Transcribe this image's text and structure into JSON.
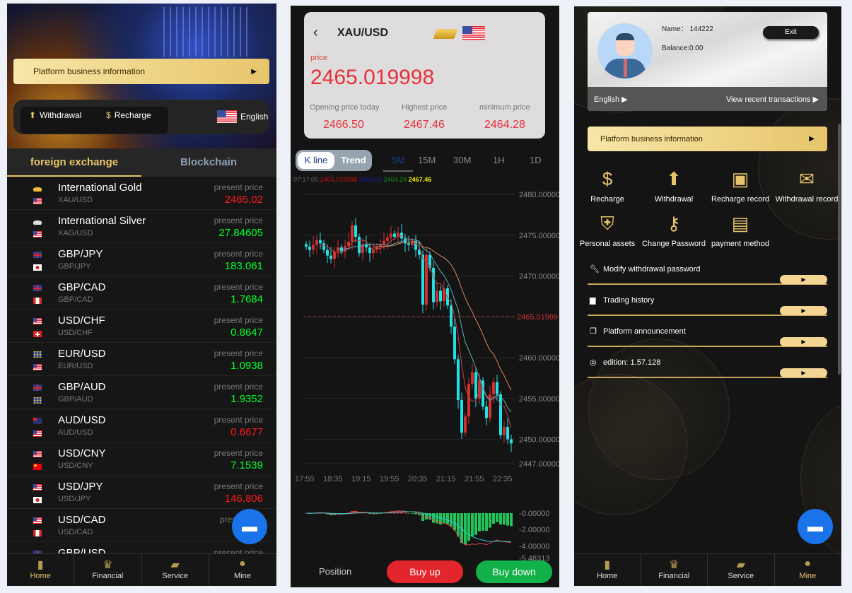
{
  "home": {
    "banner": "Platform business information",
    "withdrawal": "Withdrawal",
    "recharge": "Recharge",
    "language": "English",
    "tabs": [
      "foreign exchange",
      "Blockchain"
    ],
    "price_label": "present price",
    "rows": [
      {
        "name": "International Gold",
        "code": "XAU/USD",
        "price": "2465.02",
        "dir": "down",
        "f1": "gold",
        "f2": "us"
      },
      {
        "name": "International Silver",
        "code": "XAG/USD",
        "price": "27.84605",
        "dir": "up",
        "f1": "silver",
        "f2": "us"
      },
      {
        "name": "GBP/JPY",
        "code": "GBP/JPY",
        "price": "183.061",
        "dir": "up",
        "f1": "gb",
        "f2": "jp"
      },
      {
        "name": "GBP/CAD",
        "code": "GBP/CAD",
        "price": "1.7684",
        "dir": "up",
        "f1": "gb",
        "f2": "ca"
      },
      {
        "name": "USD/CHF",
        "code": "USD/CHF",
        "price": "0.8647",
        "dir": "up",
        "f1": "us",
        "f2": "ch"
      },
      {
        "name": "EUR/USD",
        "code": "EUR/USD",
        "price": "1.0938",
        "dir": "up",
        "f1": "eu",
        "f2": "us"
      },
      {
        "name": "GBP/AUD",
        "code": "GBP/AUD",
        "price": "1.9352",
        "dir": "up",
        "f1": "gb",
        "f2": "eu"
      },
      {
        "name": "AUD/USD",
        "code": "AUD/USD",
        "price": "0.6677",
        "dir": "down",
        "f1": "au",
        "f2": "us"
      },
      {
        "name": "USD/CNY",
        "code": "USD/CNY",
        "price": "7.1539",
        "dir": "up",
        "f1": "us",
        "f2": "cn"
      },
      {
        "name": "USD/JPY",
        "code": "USD/JPY",
        "price": "146.806",
        "dir": "down",
        "f1": "us",
        "f2": "jp"
      },
      {
        "name": "USD/CAD",
        "code": "USD/CAD",
        "price": "",
        "dir": "up",
        "f1": "us",
        "f2": "ca"
      },
      {
        "name": "GBP/USD",
        "code": "",
        "price": "",
        "dir": "up",
        "f1": "gb",
        "f2": "us"
      }
    ],
    "price_label_partial": "prese",
    "nav": [
      "Home",
      "Financial",
      "Service",
      "Mine"
    ]
  },
  "colors": {
    "up": "#00ff2a",
    "down": "#ff1a1a",
    "gold": "#e8c46a",
    "candle_up": "#d2302e",
    "candle_down": "#1de2e8"
  },
  "detail": {
    "symbol": "XAU/USD",
    "price_label": "price",
    "price": "2465.019998",
    "stats": [
      {
        "label": "Opening price today",
        "value": "2466.50"
      },
      {
        "label": "Highest price",
        "value": "2467.46"
      },
      {
        "label": "minimum price",
        "value": "2464.28"
      }
    ],
    "modes": [
      "K line",
      "Trend"
    ],
    "timeframes": [
      "5M",
      "15M",
      "30M",
      "1H",
      "1D"
    ],
    "active_timeframe": "5M",
    "info": {
      "time": "07:17:00",
      "price": "2465.019998",
      "open": "2466.50",
      "low": "2464.28",
      "high": "2467.46"
    },
    "position": "Position",
    "buy_up": "Buy up",
    "buy_down": "Buy down"
  },
  "kline": {
    "y_ticks": [
      "2480.00000",
      "2475.00000",
      "2470.00000",
      "2460.00000",
      "2455.00000",
      "2450.00000",
      "2447.00000"
    ],
    "y_values": [
      2480,
      2475,
      2470,
      2460,
      2455,
      2450,
      2447
    ],
    "current_label": "2465.01999",
    "current": 2465.02,
    "x_ticks": [
      "17:55",
      "18:35",
      "19:15",
      "19:55",
      "20:35",
      "21:15",
      "21:55",
      "22:35"
    ],
    "closes": [
      2473.6,
      2473.2,
      2473.8,
      2474.4,
      2474.0,
      2473.2,
      2472.5,
      2472.1,
      2473.0,
      2473.5,
      2473.0,
      2473.7,
      2474.2,
      2476.2,
      2474.8,
      2472.8,
      2473.9,
      2473.5,
      2472.8,
      2473.2,
      2473.6,
      2473.8,
      2474.3,
      2474.7,
      2475.2,
      2474.8,
      2475.3,
      2474.6,
      2474.0,
      2473.8,
      2474.3,
      2473.2,
      2472.6,
      2466.5,
      2472.6,
      2471.0,
      2466.8,
      2468.2,
      2466.9,
      2468.5,
      2466.4,
      2463.8,
      2459.8,
      2454.8,
      2450.8,
      2452.8,
      2456.8,
      2458.2,
      2455.0,
      2457.2,
      2454.0,
      2452.6,
      2455.5,
      2457.0,
      2455.5,
      2450.5,
      2451.5,
      2450.0,
      2449.5
    ],
    "macd_ticks": [
      "-0.00000",
      "-2.00000",
      "-4.00000",
      "-5.48313"
    ]
  },
  "mine": {
    "name_label": "Name：",
    "name": "144222",
    "balance": "Balance:0.00",
    "exit": "Exit",
    "language": "English",
    "recent": "View recent transactions",
    "banner": "Platform business information",
    "grid": [
      "Recharge",
      "Withdrawal",
      "Recharge record",
      "Withdrawal record",
      "Personal assets",
      "Change Password",
      "payment method"
    ],
    "list": [
      "Modify withdrawal password",
      "Trading history",
      "Platform announcement"
    ],
    "edition": "edition:  1.57.128",
    "nav": [
      "Home",
      "Financial",
      "Service",
      "Mine"
    ]
  }
}
